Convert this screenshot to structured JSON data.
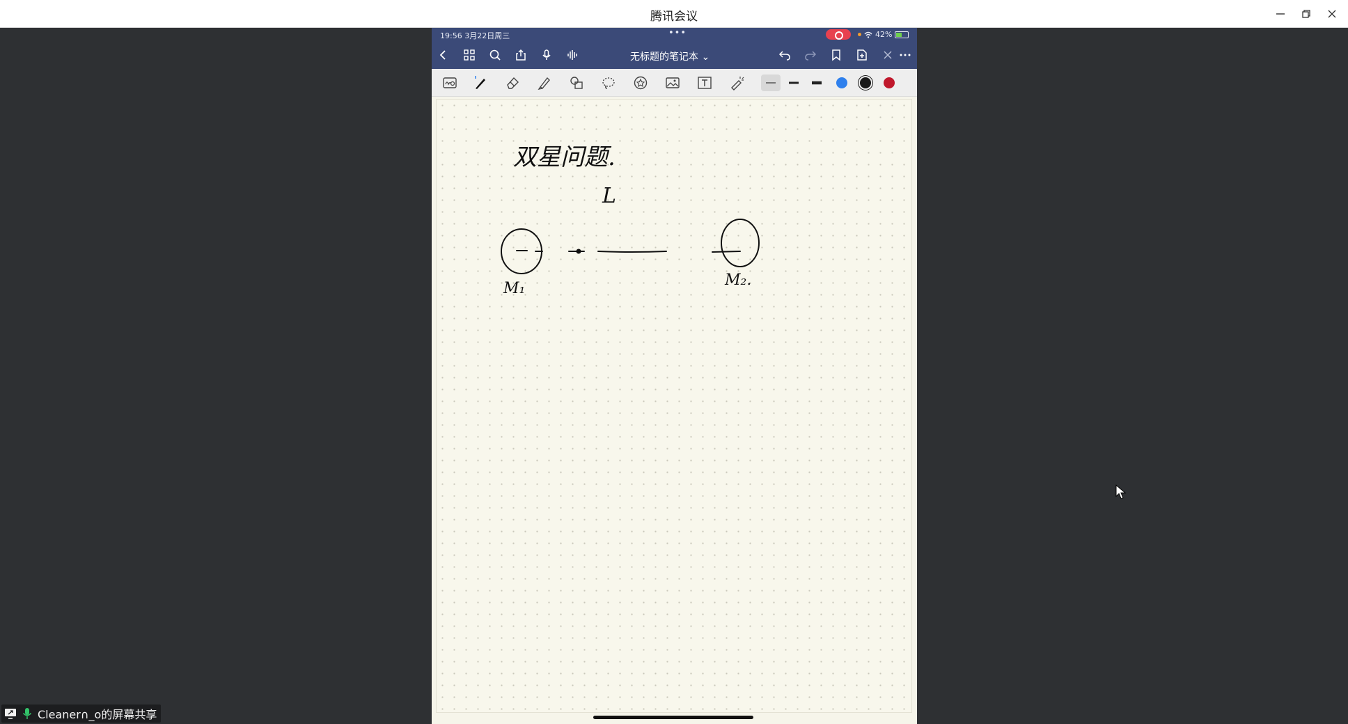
{
  "window": {
    "title": "腾讯会议"
  },
  "ipad": {
    "status": {
      "time": "19:56  3月22日周三",
      "dots": "•••",
      "battery": "42%"
    },
    "nav": {
      "title": "无标题的笔记本 ⌄"
    },
    "toolbar": {
      "colors": {
        "blue": "#2f80ed",
        "black": "#1a1a1a",
        "red": "#c0182c"
      }
    },
    "note": {
      "handwriting": [
        "双星问题.",
        "L",
        "M₁",
        "M₂."
      ]
    }
  },
  "share": {
    "label": "Cleaner∩_o的屏幕共享"
  }
}
